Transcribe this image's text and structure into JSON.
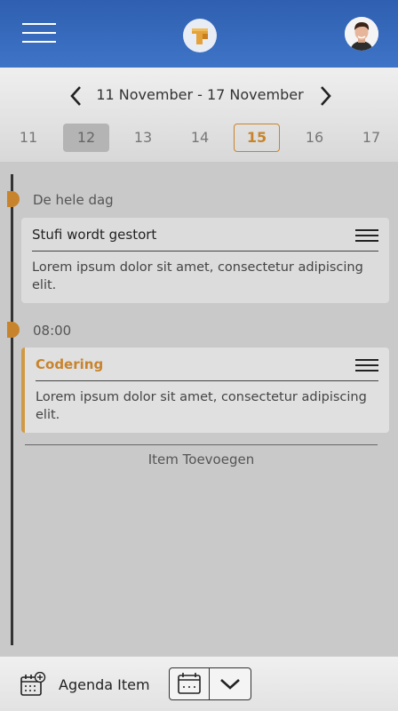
{
  "header": {
    "menu_icon": "hamburger-menu-icon",
    "logo_icon": "app-logo-icon",
    "avatar_icon": "user-avatar-icon"
  },
  "week": {
    "range": "11 November - 17 November",
    "prev_icon": "chevron-left-icon",
    "next_icon": "chevron-right-icon",
    "days": [
      "11",
      "12",
      "13",
      "14",
      "15",
      "16",
      "17"
    ],
    "selected_day": "12",
    "today": "15"
  },
  "timeline": {
    "all_day_label": "De hele dag",
    "time_label": "08:00",
    "cards": [
      {
        "title": "Stufi wordt gestort",
        "body": "Lorem ipsum dolor sit amet, consectetur adipiscing elit."
      },
      {
        "title": "Codering",
        "body": "Lorem ipsum dolor sit amet, consectetur adipiscing elit."
      }
    ],
    "add_item": "Item Toevoegen"
  },
  "footer": {
    "agenda_label": "Agenda Item",
    "agenda_icon": "calendar-add-icon",
    "calendar_view_icon": "calendar-icon",
    "dropdown_icon": "chevron-down-icon"
  },
  "colors": {
    "header_blue": "#3e74c7",
    "accent_orange": "#c8842c"
  }
}
